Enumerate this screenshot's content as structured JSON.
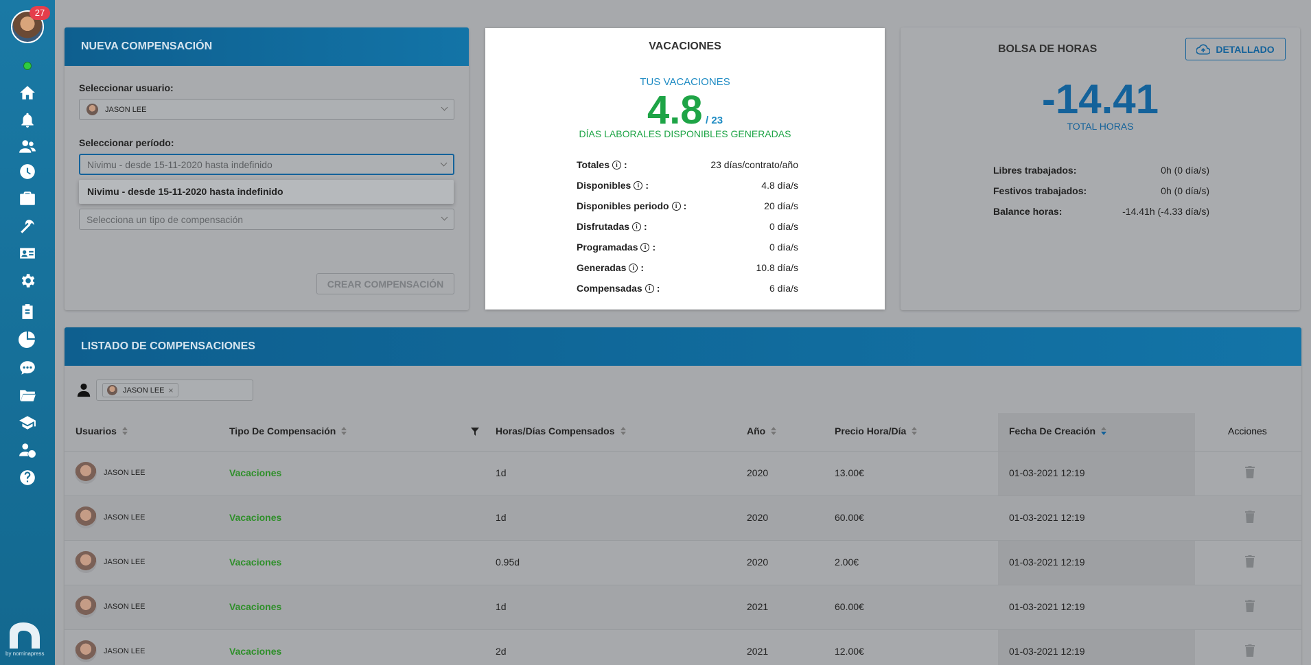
{
  "sidebar": {
    "notifications_count": "27",
    "logo_text": "by nominapress"
  },
  "nueva": {
    "title": "NUEVA COMPENSACIÓN",
    "user_label": "Seleccionar usuario:",
    "user_value": "JASON LEE",
    "period_label": "Seleccionar período:",
    "period_value": "Nivimu - desde 15-11-2020 hasta indefinido",
    "dropdown_option": "Nivimu - desde 15-11-2020 hasta indefinido",
    "tipo_placeholder": "Selecciona un tipo de compensación",
    "create_button": "CREAR COMPENSACIÓN"
  },
  "vacaciones": {
    "title": "VACACIONES",
    "subtitle": "TUS VACACIONES",
    "available": "4.8",
    "total": "/ 23",
    "caption": "DÍAS LABORALES DISPONIBLES GENERADAS",
    "rows": [
      {
        "label": "Totales",
        "value": "23 días/contrato/año"
      },
      {
        "label": "Disponibles",
        "value": "4.8 día/s"
      },
      {
        "label": "Disponibles periodo",
        "value": "20 día/s"
      },
      {
        "label": "Disfrutadas",
        "value": "0 día/s"
      },
      {
        "label": "Programadas",
        "value": "0 día/s"
      },
      {
        "label": "Generadas",
        "value": "10.8 día/s"
      },
      {
        "label": "Compensadas",
        "value": "6 día/s"
      }
    ]
  },
  "bolsa": {
    "title": "BOLSA DE HORAS",
    "detail_button": "DETALLADO",
    "total_value": "-14.41",
    "total_label": "TOTAL HORAS",
    "rows": [
      {
        "label": "Libres trabajados:",
        "value": "0h (0 día/s)"
      },
      {
        "label": "Festivos trabajados:",
        "value": "0h (0 día/s)"
      },
      {
        "label": "Balance horas:",
        "value": "-14.41h (-4.33 día/s)"
      }
    ]
  },
  "listado": {
    "title": "LISTADO DE COMPENSACIONES",
    "filter_chip": "JASON LEE",
    "columns": [
      "Usuarios",
      "Tipo De Compensación",
      "Horas/Días Compensados",
      "Año",
      "Precio Hora/Día",
      "Fecha De Creación",
      "Acciones"
    ],
    "rows": [
      {
        "user": "JASON LEE",
        "tipo": "Vacaciones",
        "horas": "1d",
        "anio": "2020",
        "precio": "13.00€",
        "fecha": "01-03-2021 12:19"
      },
      {
        "user": "JASON LEE",
        "tipo": "Vacaciones",
        "horas": "1d",
        "anio": "2020",
        "precio": "60.00€",
        "fecha": "01-03-2021 12:19"
      },
      {
        "user": "JASON LEE",
        "tipo": "Vacaciones",
        "horas": "0.95d",
        "anio": "2020",
        "precio": "2.00€",
        "fecha": "01-03-2021 12:19"
      },
      {
        "user": "JASON LEE",
        "tipo": "Vacaciones",
        "horas": "1d",
        "anio": "2021",
        "precio": "60.00€",
        "fecha": "01-03-2021 12:19"
      },
      {
        "user": "JASON LEE",
        "tipo": "Vacaciones",
        "horas": "2d",
        "anio": "2021",
        "precio": "12.00€",
        "fecha": "01-03-2021 12:19"
      }
    ]
  },
  "colors": {
    "sidebar": "#1a79a5",
    "header": "#1374a7",
    "green": "#1ea446",
    "blue": "#14629a"
  }
}
